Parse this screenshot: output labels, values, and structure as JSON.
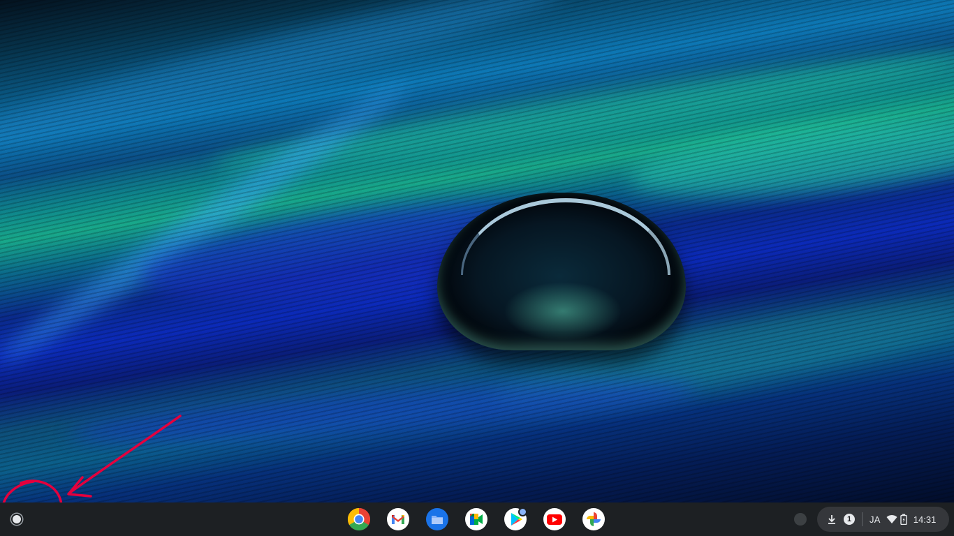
{
  "desktop": {
    "wallpaper": "peacock-feather-water-drop",
    "accent_colors": [
      "#0b2ab8",
      "#0d78b5",
      "#18a88a",
      "#061634"
    ]
  },
  "annotation": {
    "color": "#e4003d",
    "target": "launcher-button"
  },
  "shelf": {
    "launcher_icon": "launcher-circle-icon",
    "apps": [
      {
        "id": "chrome",
        "icon": "chrome-icon"
      },
      {
        "id": "gmail",
        "icon": "gmail-icon"
      },
      {
        "id": "files",
        "icon": "files-folder-icon"
      },
      {
        "id": "meet",
        "icon": "google-meet-icon"
      },
      {
        "id": "play-store",
        "icon": "play-store-icon",
        "has_notification_badge": true
      },
      {
        "id": "youtube",
        "icon": "youtube-icon"
      },
      {
        "id": "photos",
        "icon": "google-photos-icon"
      }
    ],
    "status_tray": {
      "download_icon": "download-icon",
      "notification_count": "1",
      "ime": "JA",
      "wifi_icon": "wifi-icon",
      "battery_icon": "battery-icon",
      "time": "14:31"
    }
  }
}
